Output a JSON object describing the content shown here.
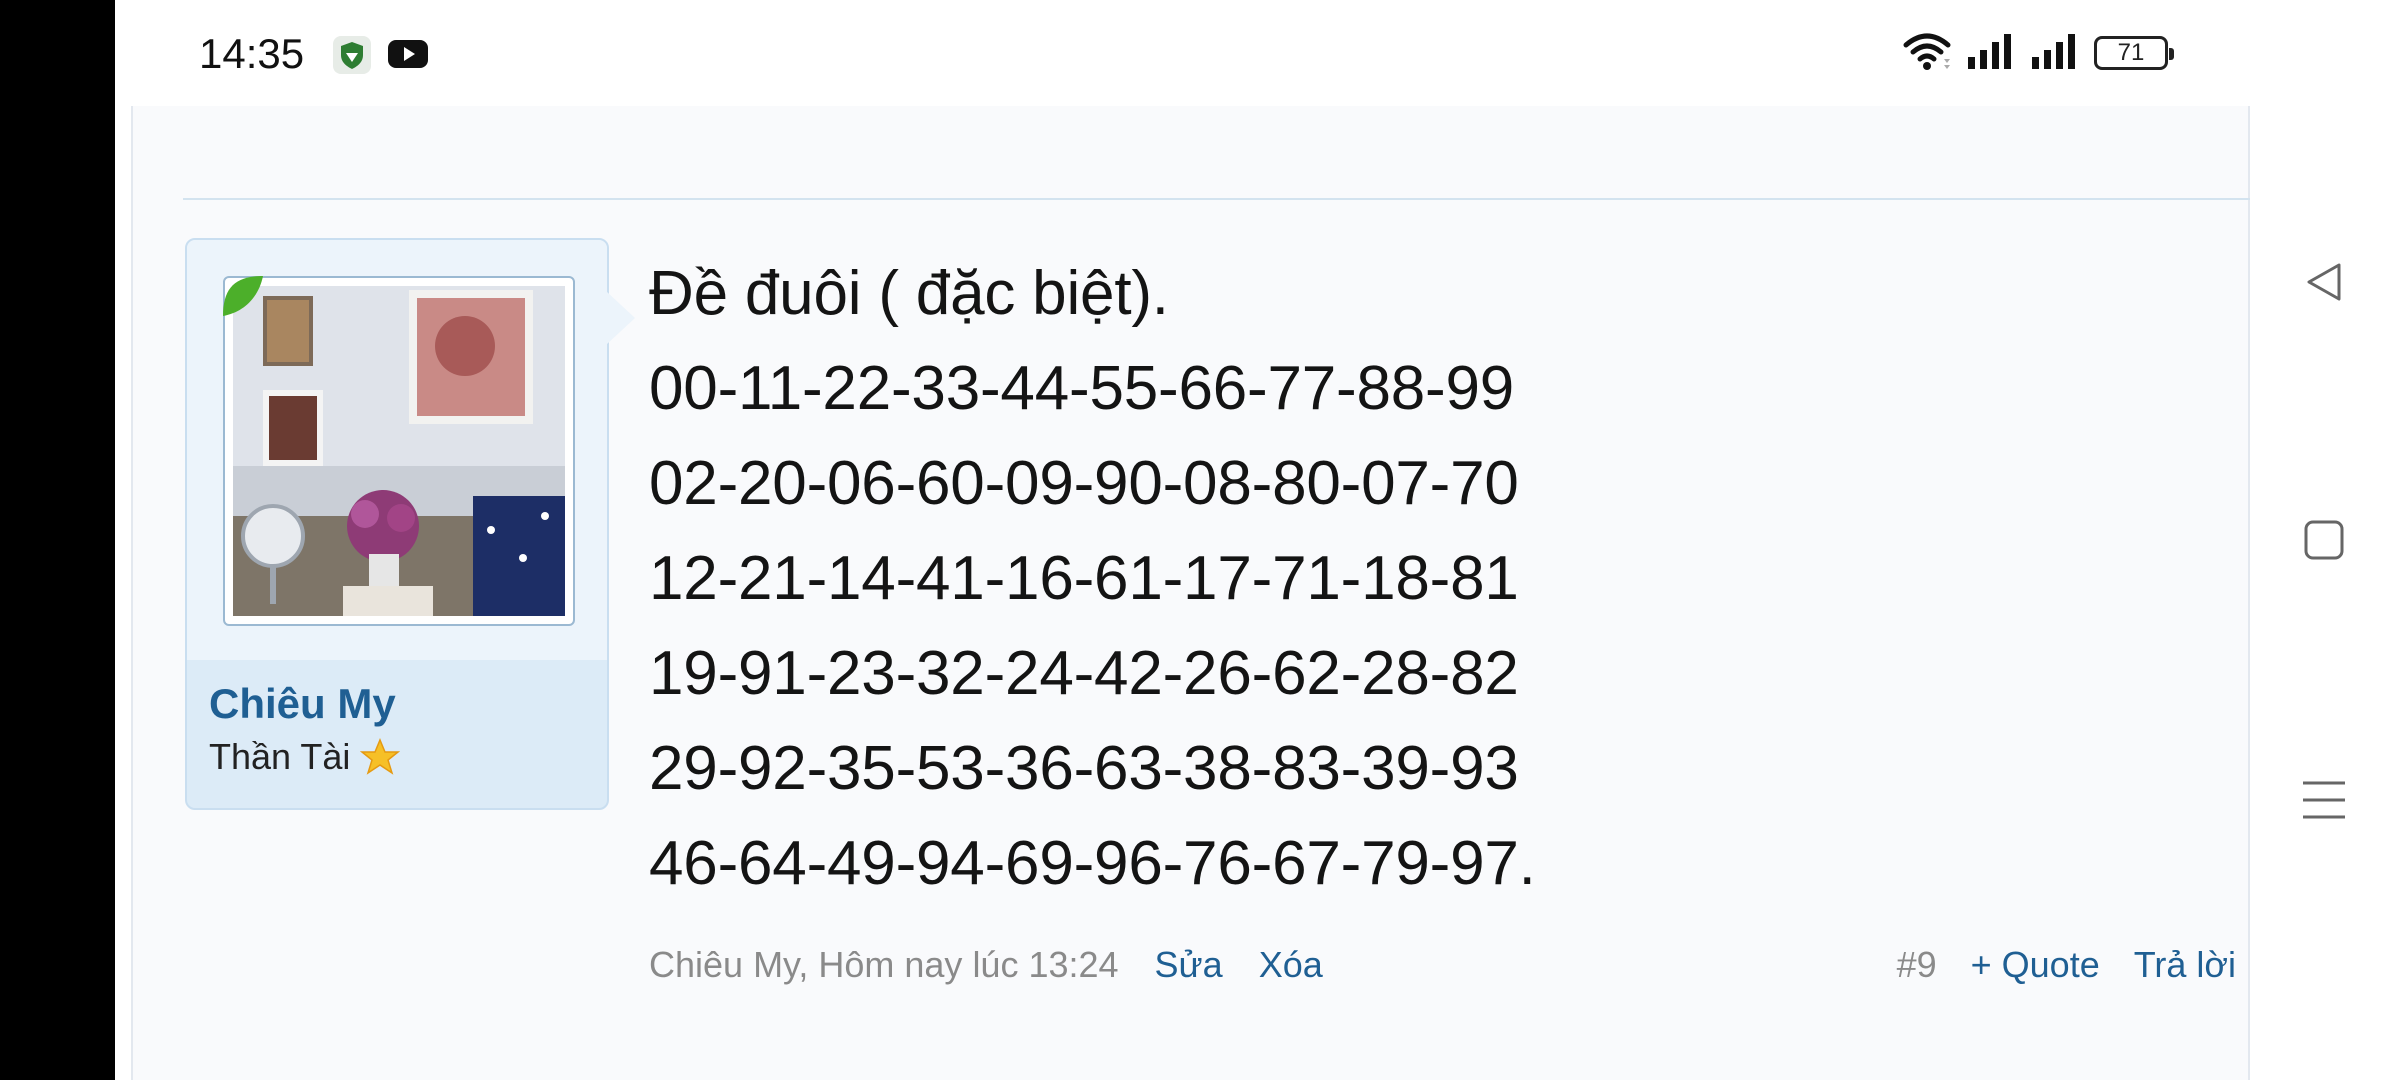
{
  "status_bar": {
    "time": "14:35",
    "battery": "71",
    "icons": [
      "shield-icon",
      "youtube-icon",
      "wifi-icon",
      "signal-icon",
      "signal-icon",
      "battery-icon"
    ]
  },
  "user": {
    "name": "Chiêu My",
    "title": "Thần Tài",
    "avatar_icon": "avatar-photo",
    "badge_icon": "star-icon"
  },
  "post": {
    "lines": [
      "Đề đuôi ( đặc biệt).",
      "00-11-22-33-44-55-66-77-88-99",
      "02-20-06-60-09-90-08-80-07-70",
      "12-21-14-41-16-61-17-71-18-81",
      "19-91-23-32-24-42-26-62-28-82",
      "29-92-35-53-36-63-38-83-39-93",
      "46-64-49-94-69-96-76-67-79-97."
    ],
    "meta": "Chiêu My, Hôm nay lúc 13:24",
    "edit_label": "Sửa",
    "delete_label": "Xóa",
    "number": "#9",
    "quote_label": "+ Quote",
    "reply_label": "Trả lời"
  },
  "nav": {
    "icons": [
      "back-icon",
      "home-icon",
      "recents-icon"
    ]
  },
  "colors": {
    "link": "#1f5f93",
    "card_bg": "#dcebf7",
    "meta_text": "#8a8a8a"
  }
}
